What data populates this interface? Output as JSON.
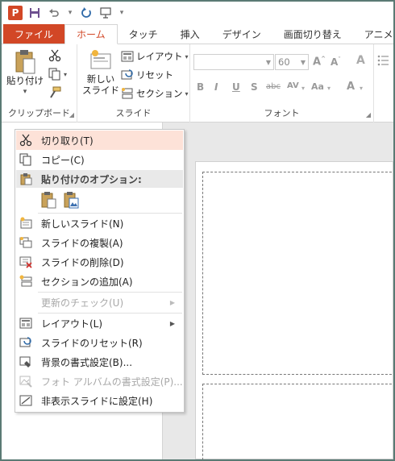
{
  "app": {
    "logo_letter": "P"
  },
  "tabs": [
    "ファイル",
    "ホーム",
    "タッチ",
    "挿入",
    "デザイン",
    "画面切り替え",
    "アニメーション"
  ],
  "ribbon": {
    "clipboard": {
      "paste_label_1": "貼り付け",
      "group_label": "クリップボード"
    },
    "slides": {
      "new_slide_line1": "新しい",
      "new_slide_line2": "スライド",
      "layout_label": "レイアウト",
      "reset_label": "リセット",
      "section_label": "セクション",
      "group_label": "スライド"
    },
    "font": {
      "font_name": "",
      "font_size": "60",
      "group_label": "フォント",
      "format_buttons": [
        "B",
        "I",
        "U",
        "S",
        "abc",
        "AV",
        "Aa",
        "A"
      ]
    }
  },
  "context_menu": {
    "items": [
      {
        "label": "切り取り(T)",
        "enabled": true,
        "icon": "scissors-icon"
      },
      {
        "label": "コピー(C)",
        "enabled": true,
        "icon": "copy-icon"
      }
    ],
    "paste_header": "貼り付けのオプション:",
    "paste_options": [
      "paste-keep-formatting-icon",
      "paste-picture-icon"
    ],
    "items2": [
      {
        "label": "新しいスライド(N)",
        "enabled": true,
        "icon": "new-slide-icon"
      },
      {
        "label": "スライドの複製(A)",
        "enabled": true,
        "icon": "duplicate-slide-icon"
      },
      {
        "label": "スライドの削除(D)",
        "enabled": true,
        "icon": "delete-slide-icon"
      },
      {
        "label": "セクションの追加(A)",
        "enabled": true,
        "icon": "add-section-icon"
      }
    ],
    "check_updates": {
      "label": "更新のチェック(U)",
      "enabled": false
    },
    "items3": [
      {
        "label": "レイアウト(L)",
        "enabled": true,
        "icon": "layout-icon",
        "submenu": true
      },
      {
        "label": "スライドのリセット(R)",
        "enabled": true,
        "icon": "reset-slide-icon"
      },
      {
        "label": "背景の書式設定(B)...",
        "enabled": true,
        "icon": "format-background-icon"
      },
      {
        "label": "フォト アルバムの書式設定(P)...",
        "enabled": false,
        "icon": "photo-album-icon"
      },
      {
        "label": "非表示スライドに設定(H)",
        "enabled": true,
        "icon": "hide-slide-icon"
      }
    ]
  },
  "colors": {
    "accent": "#d24726",
    "highlight": "#fde2d8"
  }
}
